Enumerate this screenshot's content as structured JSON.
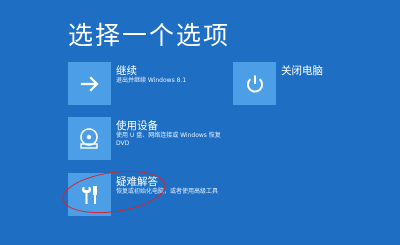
{
  "screen": {
    "title": "选择一个选项",
    "background_color": "#1e6fc4",
    "tile_color": "#4c9fe6",
    "highlight_color": "#d8232a"
  },
  "options": {
    "continue": {
      "title": "继续",
      "description": "退出并继续 Windows 8.1",
      "icon": "arrow-right-icon"
    },
    "shutdown": {
      "title": "关闭电脑",
      "icon": "power-icon"
    },
    "use_device": {
      "title": "使用设备",
      "description": "使用 U 盘、网络连接或 Windows 恢复 DVD",
      "icon": "disc-drive-icon"
    },
    "troubleshoot": {
      "title": "疑难解答",
      "description": "恢复或初始化电脑，或者使用高级工具",
      "icon": "tools-icon",
      "circled": true
    }
  }
}
